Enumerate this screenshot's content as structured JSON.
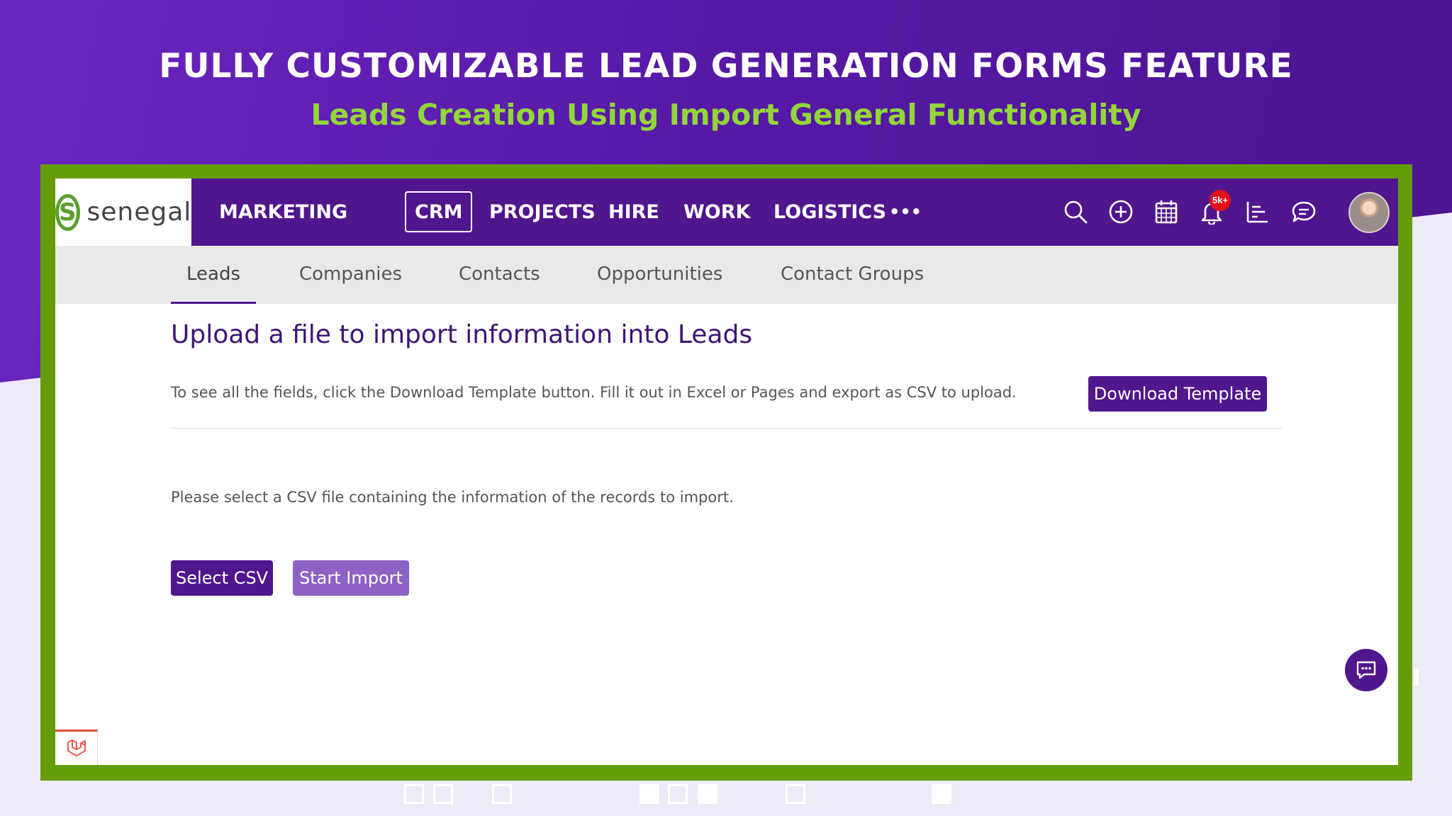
{
  "hero": {
    "title": "FULLY CUSTOMIZABLE LEAD GENERATION FORMS FEATURE",
    "subtitle": "Leads Creation Using Import General Functionality"
  },
  "app": {
    "logo_text": "senegal",
    "brand_color": "#4f168d",
    "accent_green": "#659d0a"
  },
  "topnav": {
    "items": [
      "MARKETING",
      "CRM",
      "PROJECTS",
      "HIRE",
      "WORK",
      "LOGISTICS"
    ],
    "active": "CRM",
    "more_label": "•••",
    "notification_badge": "5k+",
    "icons": [
      "search-icon",
      "add-circle-icon",
      "calendar-icon",
      "bell-icon",
      "list-chart-icon",
      "chat-icon"
    ]
  },
  "subnav": {
    "items": [
      "Leads",
      "Companies",
      "Contacts",
      "Opportunities",
      "Contact Groups"
    ],
    "active": "Leads"
  },
  "content": {
    "title": "Upload a file to import information into Leads",
    "template_hint": "To see all the fields, click the Download Template button. Fill it out in Excel or Pages and export as CSV to upload.",
    "download_button": "Download Template",
    "select_hint": "Please select a CSV file containing the information of the records to import.",
    "select_button": "Select CSV",
    "import_button": "Start Import"
  }
}
